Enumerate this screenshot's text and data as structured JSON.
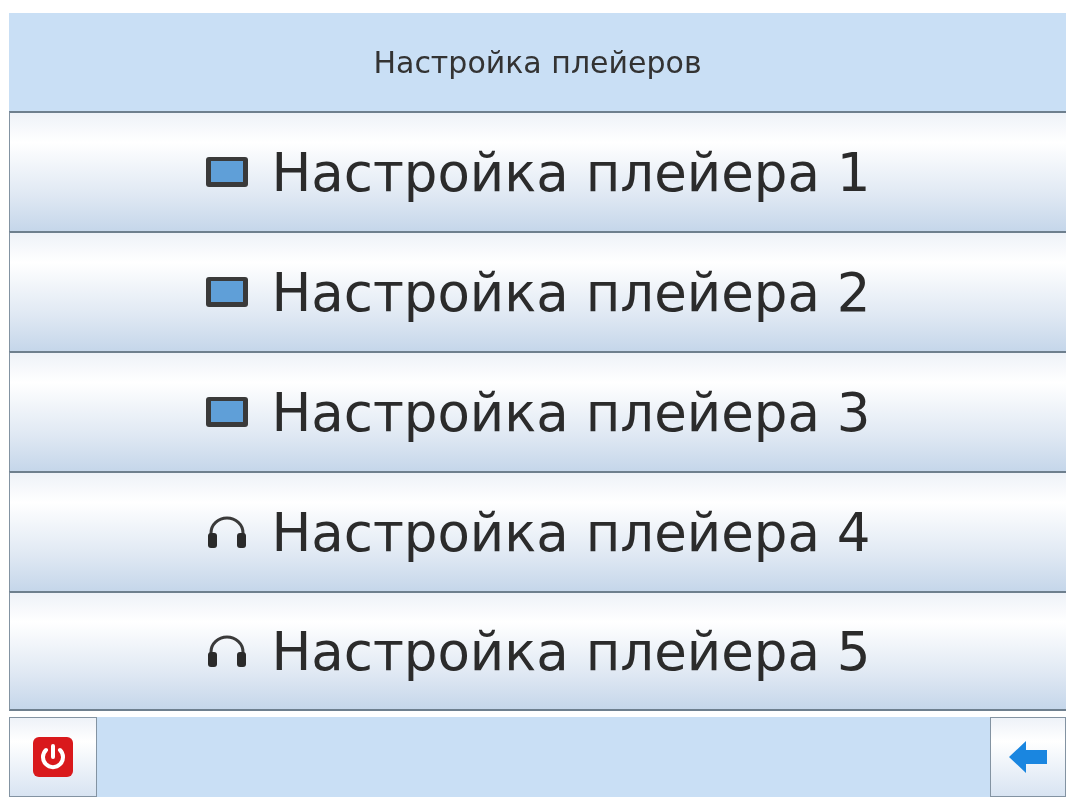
{
  "header": {
    "title": "Настройка плейеров"
  },
  "players": [
    {
      "label": "Настройка плейера 1",
      "kind": "display"
    },
    {
      "label": "Настройка плейера 2",
      "kind": "display"
    },
    {
      "label": "Настройка плейера 3",
      "kind": "display"
    },
    {
      "label": "Настройка плейера 4",
      "kind": "headphones"
    },
    {
      "label": "Настройка плейера 5",
      "kind": "headphones"
    }
  ]
}
